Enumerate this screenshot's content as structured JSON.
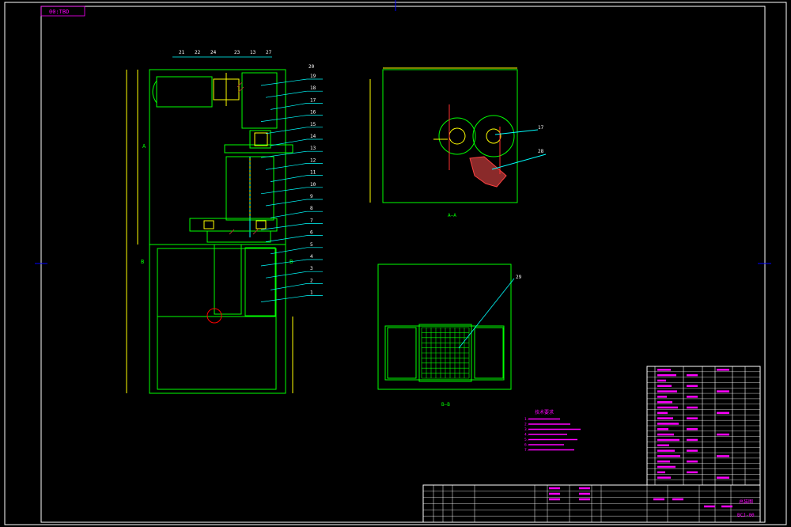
{
  "drawing": {
    "stamp_top_left": "00:TBD",
    "view_label_aa": "A—A",
    "view_label_bb": "B—B",
    "section_mark_a": "A",
    "section_mark_b": "B",
    "balloons_top": [
      "21",
      "22",
      "24",
      "23",
      "13",
      "27",
      "20"
    ],
    "balloons_right": [
      "19",
      "18",
      "17",
      "16",
      "15",
      "14",
      "13",
      "12",
      "11",
      "10",
      "9",
      "8",
      "7",
      "6",
      "5",
      "4",
      "3",
      "2",
      "1"
    ],
    "aa_balloons": [
      "17",
      "28"
    ],
    "bb_balloon": "29",
    "tech_req_title": "技术要求",
    "tech_req_lines": [
      "1.",
      "2.",
      "3.",
      "4.",
      "5.",
      "6.",
      "7."
    ],
    "title_block_name": "总装图",
    "title_block_code": "BCJ-00",
    "colors": {
      "frame": "#ffffff",
      "outline": "#00ff00",
      "leader": "#00ffff",
      "text": "#ff00ff",
      "accent": "#ffff00",
      "section": "#ff0000",
      "hatch": "#a03030"
    }
  }
}
